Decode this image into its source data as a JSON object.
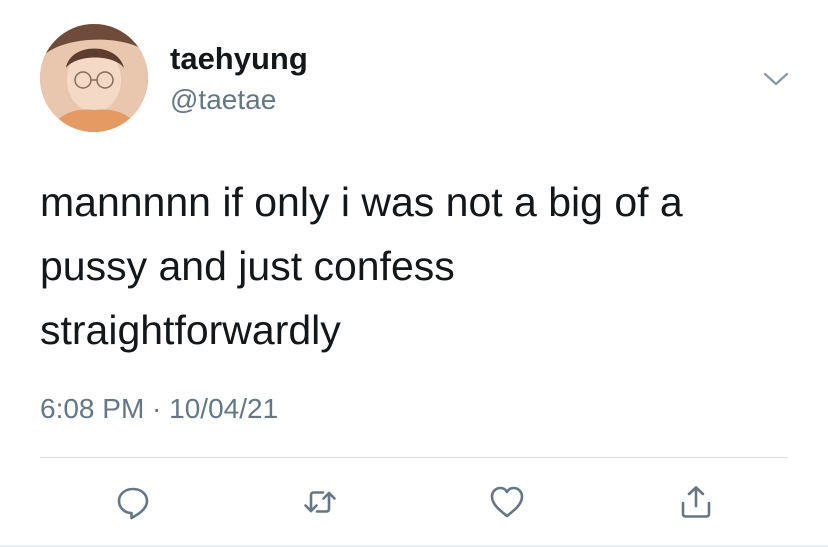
{
  "tweet": {
    "display_name": "taehyung",
    "handle": "@taetae",
    "text": "mannnnn if only i was not a big of a\npussy and just confess\nstraightforwardly",
    "timestamp": "6:08 PM · 10/04/21"
  },
  "icons": {
    "menu": "chevron-down-icon",
    "reply": "reply-icon",
    "retweet": "retweet-icon",
    "like": "heart-icon",
    "share": "share-icon"
  },
  "colors": {
    "text": "#14171a",
    "secondary": "#657786",
    "divider": "#d8dde2",
    "icon": "#657786"
  }
}
